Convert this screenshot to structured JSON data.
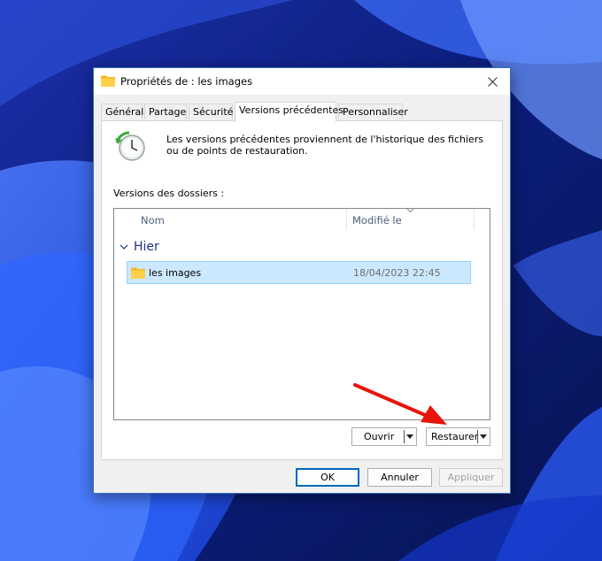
{
  "dialog": {
    "title": "Propriétés de : les images"
  },
  "tabs": [
    {
      "label": "Général"
    },
    {
      "label": "Partage"
    },
    {
      "label": "Sécurité"
    },
    {
      "label": "Versions précédentes",
      "active": true
    },
    {
      "label": "Personnaliser"
    }
  ],
  "panel": {
    "description": "Les versions précédentes proviennent de l'historique des fichiers ou de points de restauration.",
    "versions_label": "Versions des dossiers :",
    "columns": {
      "name": "Nom",
      "modified": "Modifié le"
    },
    "group": "Hier",
    "rows": [
      {
        "name": "les images",
        "modified": "18/04/2023 22:45",
        "selected": true
      }
    ]
  },
  "buttons": {
    "open": "Ouvrir",
    "restore": "Restaurer",
    "ok": "OK",
    "cancel": "Annuler",
    "apply": "Appliquer"
  },
  "colors": {
    "accent": "#0067c0",
    "selection": "#cce8ff",
    "group_text": "#1e3287",
    "annotation": "#e8140c"
  },
  "icons": {
    "title": "folder-icon",
    "close": "close-icon",
    "panel": "clock-history-icon",
    "row": "folder-icon"
  }
}
